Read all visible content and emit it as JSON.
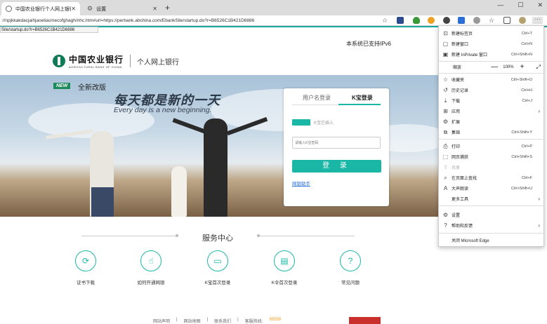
{
  "browser": {
    "tabs": [
      {
        "label": "中国农业银行个人网上银行",
        "active": true
      },
      {
        "label": "设置",
        "active": false
      }
    ],
    "address_url": ":/‌/npjkkakdacjaihjaoeliacmecofghagh/nhc.htm#url=https://perbank.abchina.com/EbankSite/startup.do?r=B6526C1B421D6886",
    "status_url": "Site/startup.do?r=B6526C1B421D6886",
    "window_controls": [
      "—",
      "☐",
      "✕"
    ]
  },
  "page": {
    "ipv6_notice": "本系统已支持IPv6",
    "logo_cn": "中国农业银行",
    "logo_en": "AGRICULTURAL BANK OF CHINA",
    "logo_sub": "个人网上银行",
    "new_badge": "NEW",
    "new_text": "全新改版",
    "slogan_cn": "每天都是新的一天",
    "slogan_en": "Every day is a new beginning.",
    "login": {
      "tab_username": "用户名登录",
      "tab_kbao": "K宝登录",
      "kbao_status": "K宝已插入",
      "password_placeholder": "请输入K宝密码",
      "login_button": "登 录",
      "help_link": "网银助手"
    },
    "services": {
      "title": "服务中心",
      "items": [
        {
          "label": "证书下载",
          "icon": "refresh-icon"
        },
        {
          "label": "如何开通网银",
          "icon": "pointer-icon"
        },
        {
          "label": "K宝首次登录",
          "icon": "card-icon"
        },
        {
          "label": "K令首次登录",
          "icon": "document-icon"
        },
        {
          "label": "常见问题",
          "icon": "question-icon"
        }
      ]
    },
    "footer": {
      "links": [
        "网站声明",
        "网站地图",
        "联系我们",
        "客服热线:"
      ],
      "hotline": "95599"
    }
  },
  "menu": {
    "items": [
      {
        "label": "新建标签页",
        "shortcut": "Ctrl+T",
        "icon": "new-tab-icon"
      },
      {
        "label": "新建窗口",
        "shortcut": "Ctrl+N",
        "icon": "new-window-icon"
      },
      {
        "label": "新建 InPrivate 窗口",
        "shortcut": "Ctrl+Shift+N",
        "icon": "inprivate-icon"
      }
    ],
    "zoom": {
      "label": "缩放",
      "minus": "—",
      "value": "100%",
      "plus": "+",
      "fullscreen": "⤢"
    },
    "items2": [
      {
        "label": "收藏夹",
        "shortcut": "Ctrl+Shift+O",
        "icon": "favorites-icon"
      },
      {
        "label": "历史记录",
        "shortcut": "Ctrl+H",
        "icon": "history-icon"
      },
      {
        "label": "下载",
        "shortcut": "Ctrl+J",
        "icon": "download-icon"
      },
      {
        "label": "应用",
        "shortcut": "",
        "icon": "apps-icon",
        "arrow": true
      },
      {
        "label": "扩展",
        "shortcut": "",
        "icon": "extensions-icon"
      },
      {
        "label": "集锦",
        "shortcut": "Ctrl+Shift+Y",
        "icon": "collections-icon"
      }
    ],
    "items3": [
      {
        "label": "打印",
        "shortcut": "Ctrl+P",
        "icon": "print-icon"
      },
      {
        "label": "网页捕获",
        "shortcut": "Ctrl+Shift+S",
        "icon": "capture-icon"
      },
      {
        "label": "共享",
        "shortcut": "",
        "icon": "share-icon",
        "disabled": true
      },
      {
        "label": "在页面上查找",
        "shortcut": "Ctrl+F",
        "icon": "find-icon"
      },
      {
        "label": "大声朗读",
        "shortcut": "Ctrl+Shift+U",
        "icon": "read-aloud-icon"
      },
      {
        "label": "更多工具",
        "shortcut": "",
        "icon": "more-tools-icon",
        "arrow": true
      }
    ],
    "items4": [
      {
        "label": "设置",
        "shortcut": "",
        "icon": "settings-icon"
      },
      {
        "label": "帮助和反馈",
        "shortcut": "",
        "icon": "help-icon",
        "arrow": true
      }
    ],
    "close_label": "关闭 Microsoft Edge"
  },
  "colors": {
    "accent": "#1ab7a6",
    "brand_green": "#0f7a56"
  }
}
